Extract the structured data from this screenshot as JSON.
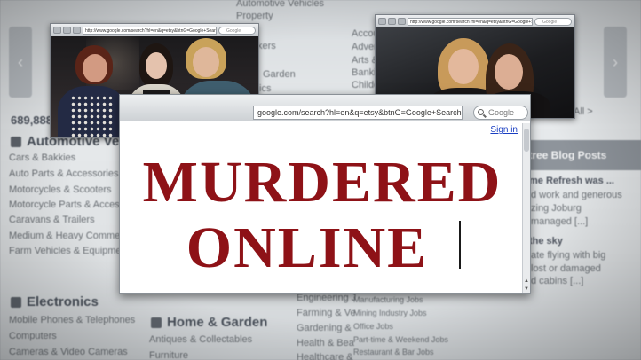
{
  "background_page": {
    "top_categories": [
      "Automotive Vehicles",
      "Property"
    ],
    "counter": "689,888",
    "sections": {
      "automotive": {
        "heading": "Automotive Vehicles",
        "items": [
          "Cars & Bakkies",
          "Auto Parts & Accessories",
          "Motorcycles & Scooters",
          "Motorcycle Parts & Accessories",
          "Caravans & Trailers",
          "Medium & Heavy Commercials",
          "Farm Vehicles & Equipment"
        ]
      },
      "electronics": {
        "heading": "Electronics",
        "items": [
          "Mobile Phones & Telephones",
          "Computers",
          "Cameras & Video Cameras"
        ]
      },
      "home_garden": {
        "heading": "Home & Garden",
        "items": [
          "Antiques & Collectables",
          "Furniture"
        ]
      },
      "middle_column": [
        "Engineering J",
        "Farming & Ve",
        "Gardening &",
        "Health & Bea",
        "Healthcare &"
      ],
      "jobs_column": [
        "Manufacturing Jobs",
        "Mining Industry Jobs",
        "Office Jobs",
        "Part-time & Weekend Jobs",
        "Restaurant & Bar Jobs"
      ],
      "right_column_top": [
        "Accou",
        "Advert",
        "Arts &",
        "Banking",
        "Childcar"
      ],
      "center_top": [
        "kers",
        "Garden",
        "ics"
      ],
      "all_link": "All >"
    },
    "blog": {
      "heading": "ntree Blog Posts",
      "lines": [
        "me Refresh was ...",
        "d work and generous",
        "zing Joburg",
        "managed [...]",
        "the sky",
        "ate flying with big",
        "lost or damaged",
        "d cabins [...]"
      ]
    }
  },
  "photo_browser_1": {
    "url": "http://www.google.com/search?hl=en&q=etsy&btnG=Google+Search&aq=f&oq=",
    "search_placeholder": "Google"
  },
  "photo_browser_2": {
    "url": "http://www.google.com/search?hl=en&q=etsy&btnG=Google+Search&aq=f&oq=",
    "search_placeholder": "Google"
  },
  "main_browser": {
    "url": "google.com/search?hl=en&q=etsy&btnG=Google+Search&aq=f&oq=",
    "search_placeholder": "Google",
    "signin": "Sign in",
    "scroll_up": "▲",
    "scroll_down": "▼"
  },
  "headline": {
    "line1": "MURDERED",
    "line2": "ONLINE",
    "color": "#8e1217"
  },
  "icons": [
    "car-icon",
    "tv-icon",
    "sofa-icon",
    "search-icon",
    "chevron-left-icon",
    "chevron-right-icon"
  ]
}
